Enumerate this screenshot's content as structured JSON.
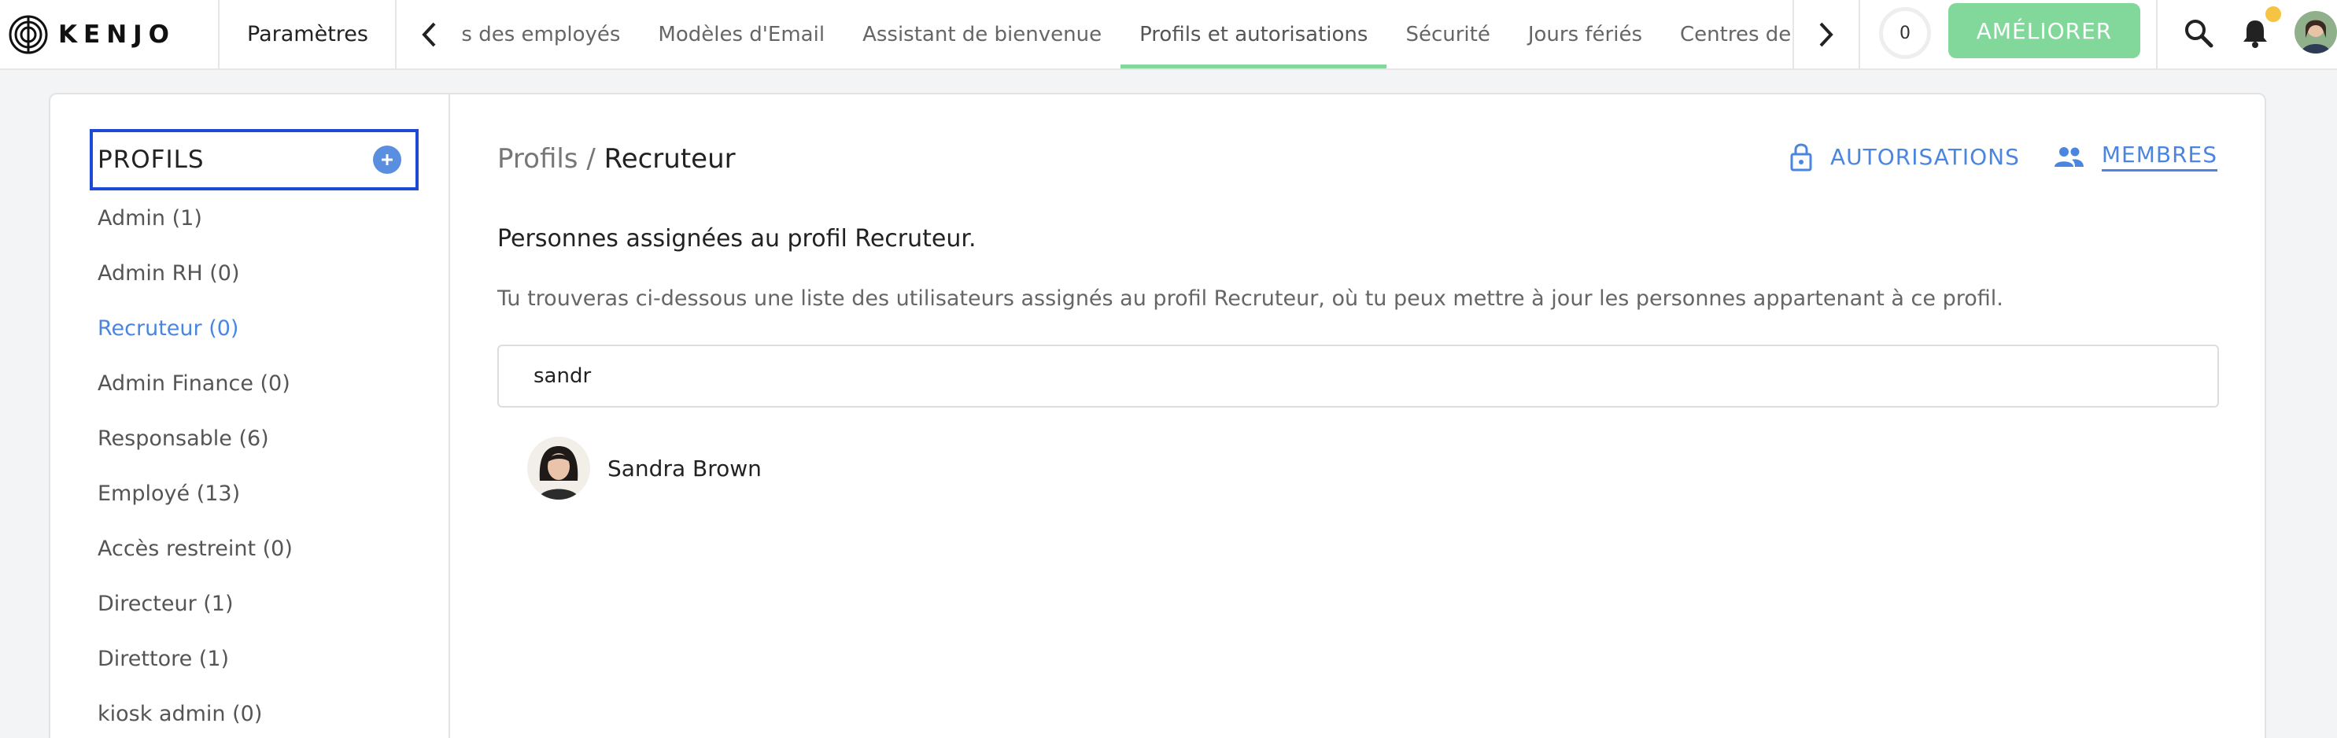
{
  "brand": {
    "name": "KENJO"
  },
  "topbar": {
    "settings_label": "Paramètres",
    "tabs": [
      {
        "label": "Champs des employés"
      },
      {
        "label": "Modèles d'Email"
      },
      {
        "label": "Assistant de bienvenue"
      },
      {
        "label": "Profils et autorisations",
        "active": true
      },
      {
        "label": "Sécurité"
      },
      {
        "label": "Jours fériés"
      },
      {
        "label": "Centres de coûts"
      }
    ],
    "counter": "0",
    "upgrade_label": "AMÉLIORER",
    "icons": [
      "chevron-left-icon",
      "chevron-right-icon",
      "search-icon",
      "bell-icon"
    ]
  },
  "sidebar": {
    "title": "PROFILS",
    "items": [
      {
        "label": "Admin (1)"
      },
      {
        "label": "Admin RH (0)"
      },
      {
        "label": "Recruteur (0)",
        "active": true
      },
      {
        "label": "Admin Finance (0)"
      },
      {
        "label": "Responsable (6)"
      },
      {
        "label": "Employé (13)"
      },
      {
        "label": "Accès restreint (0)"
      },
      {
        "label": "Directeur (1)"
      },
      {
        "label": "Direttore (1)"
      },
      {
        "label": "kiosk admin (0)"
      }
    ]
  },
  "main": {
    "breadcrumb_root": "Profils /",
    "breadcrumb_current": "Recruteur",
    "tabs": [
      {
        "label": "AUTORISATIONS",
        "icon": "lock-icon"
      },
      {
        "label": "MEMBRES",
        "icon": "people-icon",
        "active": true
      }
    ],
    "heading": "Personnes assignées au profil Recruteur.",
    "description": "Tu trouveras ci-dessous une liste des utilisateurs assignés au profil Recruteur, où tu peux mettre à jour les personnes appartenant à ce profil.",
    "search": {
      "value": "sandr"
    },
    "results": [
      {
        "name": "Sandra Brown"
      }
    ]
  },
  "colors": {
    "accent_blue": "#4a86e0",
    "accent_green": "#82d89b",
    "focus_border": "#1e49d6",
    "notification_dot": "#f6c342"
  }
}
